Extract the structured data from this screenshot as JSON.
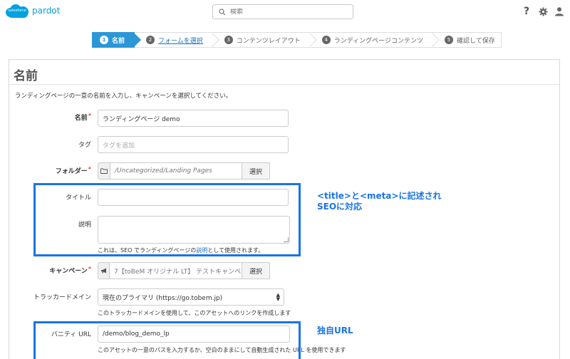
{
  "app": {
    "logo_cloud_text": "salesforce",
    "brand": "pardot",
    "search_placeholder": "検索"
  },
  "steps": [
    {
      "num": "1",
      "label": "名前"
    },
    {
      "num": "2",
      "label": "フォームを選択"
    },
    {
      "num": "3",
      "label": "コンテンツレイアウト"
    },
    {
      "num": "4",
      "label": "ランディングページコンテンツ"
    },
    {
      "num": "5",
      "label": "確認して保存"
    }
  ],
  "panel": {
    "title": "名前",
    "intro": "ランディングページの一意の名前を入力し、キャンペーンを選択してください。"
  },
  "form": {
    "name_label": "名前",
    "name_value": "ランディングページ demo",
    "tag_label": "タグ",
    "tag_placeholder": "タグを追加",
    "folder_label": "フォルダー",
    "folder_value": "/Uncategorized/Landing Pages",
    "folder_button": "選択",
    "title_label": "タイトル",
    "title_value": "",
    "desc_label": "説明",
    "desc_value": "",
    "seo_help_prefix": "これは、SEO でランディングページの",
    "seo_help_link": "説明",
    "seo_help_suffix": "として使用されます。",
    "campaign_label": "キャンペーン",
    "campaign_value": "7【toBeM オリジナル LT】 テストキャンペー",
    "campaign_button": "選択",
    "tracker_label": "トラッカードメイン",
    "tracker_value": "現在のプライマリ (https://go.tobem.jp)",
    "tracker_help": "このトラッカードメインを使用して、このアセットへのリンクを作成します",
    "vanity_label": "バニティ URL",
    "vanity_value": "/demo/blog_demo_lp",
    "vanity_help": "このアセットの一意のパスを入力するか、空白のままにして自動生成された URL を使用できます"
  },
  "annotations": {
    "seo_line1": "<title>と<meta>に記述され",
    "seo_line2": "SEOに対応",
    "vanity": "独自URL"
  },
  "colors": {
    "accent": "#2b97d6",
    "highlight": "#1a73e8",
    "brand": "#00a1e0"
  }
}
